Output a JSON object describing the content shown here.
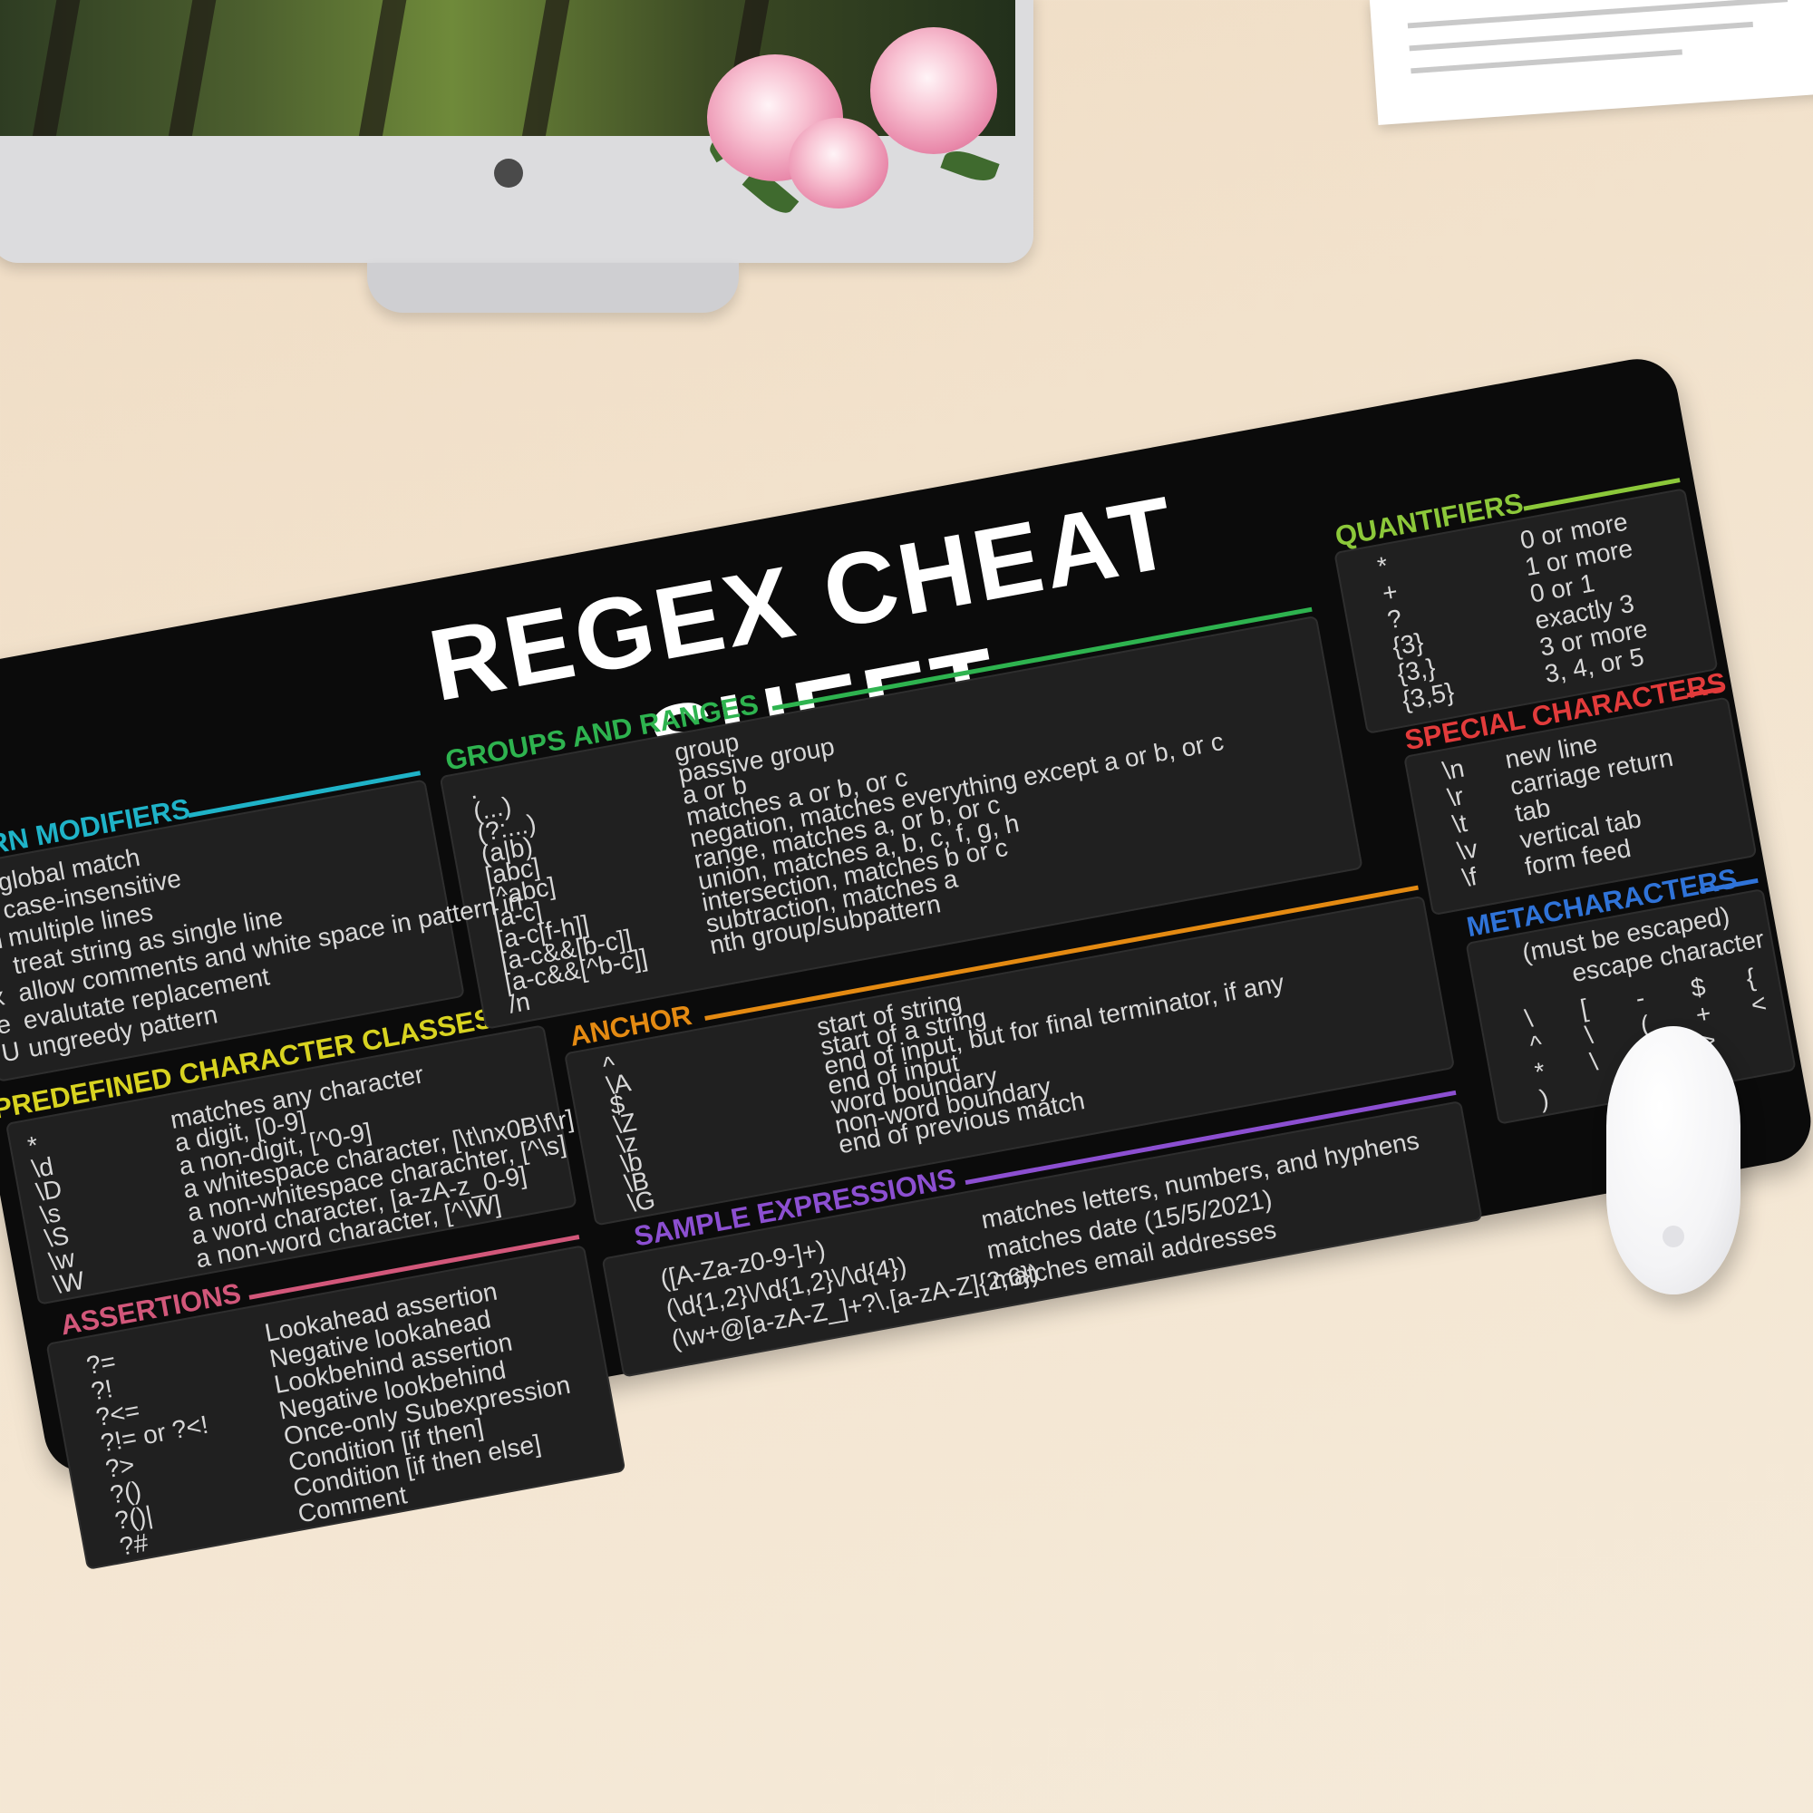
{
  "colors": {
    "cyan": "#1fb3c8",
    "yellow": "#d8d320",
    "pink": "#d2577a",
    "green": "#2eb34f",
    "orange": "#e48a12",
    "purple": "#8c4fd1",
    "lime": "#8cc83a",
    "red": "#e23b3b",
    "blue": "#2f73d8"
  },
  "title": "REGEX CHEAT SHEET",
  "pattern_modifiers": {
    "heading": "PATTERN MODIFIERS",
    "rows": [
      {
        "sym": "g",
        "desc": "global match"
      },
      {
        "sym": "i",
        "desc": "case-insensitive"
      },
      {
        "sym": "m",
        "desc": "multiple lines"
      },
      {
        "sym": "s",
        "desc": "treat string as single line"
      },
      {
        "sym": "x",
        "desc": "allow comments and white space in pattern in"
      },
      {
        "sym": "e",
        "desc": "evalutate replacement"
      },
      {
        "sym": "U",
        "desc": "ungreedy pattern"
      }
    ]
  },
  "predefined": {
    "heading": "PREDEFINED CHARACTER CLASSES",
    "rows": [
      {
        "sym": "*",
        "desc": "matches any character"
      },
      {
        "sym": "\\d",
        "desc": "a digit, [0-9]"
      },
      {
        "sym": "\\D",
        "desc": "a non-digit, [^0-9]"
      },
      {
        "sym": "\\s",
        "desc": "a whitespace character, [\\t\\nx0B\\f\\r]"
      },
      {
        "sym": "\\S",
        "desc": "a non-whitespace charachter, [^\\s]"
      },
      {
        "sym": "\\w",
        "desc": "a word character, [a-zA-z_0-9]"
      },
      {
        "sym": "\\W",
        "desc": "a non-word character, [^\\W]"
      }
    ]
  },
  "assertions": {
    "heading": "ASSERTIONS",
    "rows": [
      {
        "sym": "?=",
        "desc": "Lookahead assertion"
      },
      {
        "sym": "?!",
        "desc": "Negative lookahead"
      },
      {
        "sym": "?<=",
        "desc": "Lookbehind assertion"
      },
      {
        "sym": "?!= or ?<!",
        "desc": "Negative lookbehind"
      },
      {
        "sym": "?>",
        "desc": "Once-only Subexpression"
      },
      {
        "sym": "?()",
        "desc": "Condition [if then]"
      },
      {
        "sym": "?()|",
        "desc": "Condition [if then else]"
      },
      {
        "sym": "?#",
        "desc": "Comment"
      }
    ]
  },
  "groups": {
    "heading": "GROUPS AND RANGES",
    "rows": [
      {
        "sym": ".",
        "desc": "group"
      },
      {
        "sym": "(...)",
        "desc": "passive group"
      },
      {
        "sym": "(?:...)",
        "desc": "a or b"
      },
      {
        "sym": "(a|b)",
        "desc": "matches a or b, or c"
      },
      {
        "sym": "[abc]",
        "desc": "negation, matches everything except a or b, or c"
      },
      {
        "sym": "[^abc]",
        "desc": "range, matches a, or b, or c"
      },
      {
        "sym": "[a-c]",
        "desc": "union, matches a, b, c, f, g, h"
      },
      {
        "sym": "[a-c[f-h]]",
        "desc": "intersection, matches b or c"
      },
      {
        "sym": "[a-c&&[b-c]]",
        "desc": "subtraction, matches a"
      },
      {
        "sym": "[a-c&&[^b-c]]",
        "desc": "nth group/subpattern"
      },
      {
        "sym": "/n",
        "desc": ""
      }
    ]
  },
  "anchor": {
    "heading": "ANCHOR",
    "rows": [
      {
        "sym": "^",
        "desc": "start of string"
      },
      {
        "sym": "\\A",
        "desc": "start of a string"
      },
      {
        "sym": "$",
        "desc": "end of input, but for final terminator, if any"
      },
      {
        "sym": "\\Z",
        "desc": "end of input"
      },
      {
        "sym": "\\z",
        "desc": "word boundary"
      },
      {
        "sym": "\\b",
        "desc": "non-word boundary"
      },
      {
        "sym": "\\B",
        "desc": "end of previous match"
      },
      {
        "sym": "\\G",
        "desc": ""
      }
    ]
  },
  "samples": {
    "heading": "SAMPLE EXPRESSIONS",
    "rows": [
      {
        "sym": "([A-Za-z0-9-]+)",
        "desc": "matches letters, numbers, and hyphens"
      },
      {
        "sym": "(\\d{1,2}\\/\\d{1,2}\\/\\d{4})",
        "desc": "matches date (15/5/2021)"
      },
      {
        "sym": "(\\w+@[a-zA-Z_]+?\\.[a-zA-Z]{2,6})",
        "desc": "matches email addresses"
      }
    ]
  },
  "quantifiers": {
    "heading": "QUANTIFIERS",
    "rows": [
      {
        "sym": "*",
        "desc": "0 or more"
      },
      {
        "sym": "+",
        "desc": "1 or more"
      },
      {
        "sym": "?",
        "desc": "0 or 1"
      },
      {
        "sym": "{3}",
        "desc": "exactly 3"
      },
      {
        "sym": "{3,}",
        "desc": "3 or more"
      },
      {
        "sym": "{3,5}",
        "desc": "3, 4, or 5"
      }
    ]
  },
  "special": {
    "heading": "SPECIAL CHARACTERS",
    "rows": [
      {
        "sym": "\\n",
        "desc": "new line"
      },
      {
        "sym": "\\r",
        "desc": "carriage return"
      },
      {
        "sym": "\\t",
        "desc": "tab"
      },
      {
        "sym": "\\v",
        "desc": "vertical tab"
      },
      {
        "sym": "\\f",
        "desc": "form feed"
      }
    ]
  },
  "meta": {
    "heading": "METACHARACTERS",
    "note1": "(must be escaped)",
    "note2": "escape character",
    "symbols_row1": [
      "\\",
      "[",
      "-",
      "$",
      "{"
    ],
    "symbols_row2": [
      "^",
      "\\",
      "(",
      "+",
      "<"
    ],
    "symbols_row3": [
      "*",
      "\\",
      "|",
      ">"
    ],
    "symbols_row4": [
      ")"
    ]
  }
}
